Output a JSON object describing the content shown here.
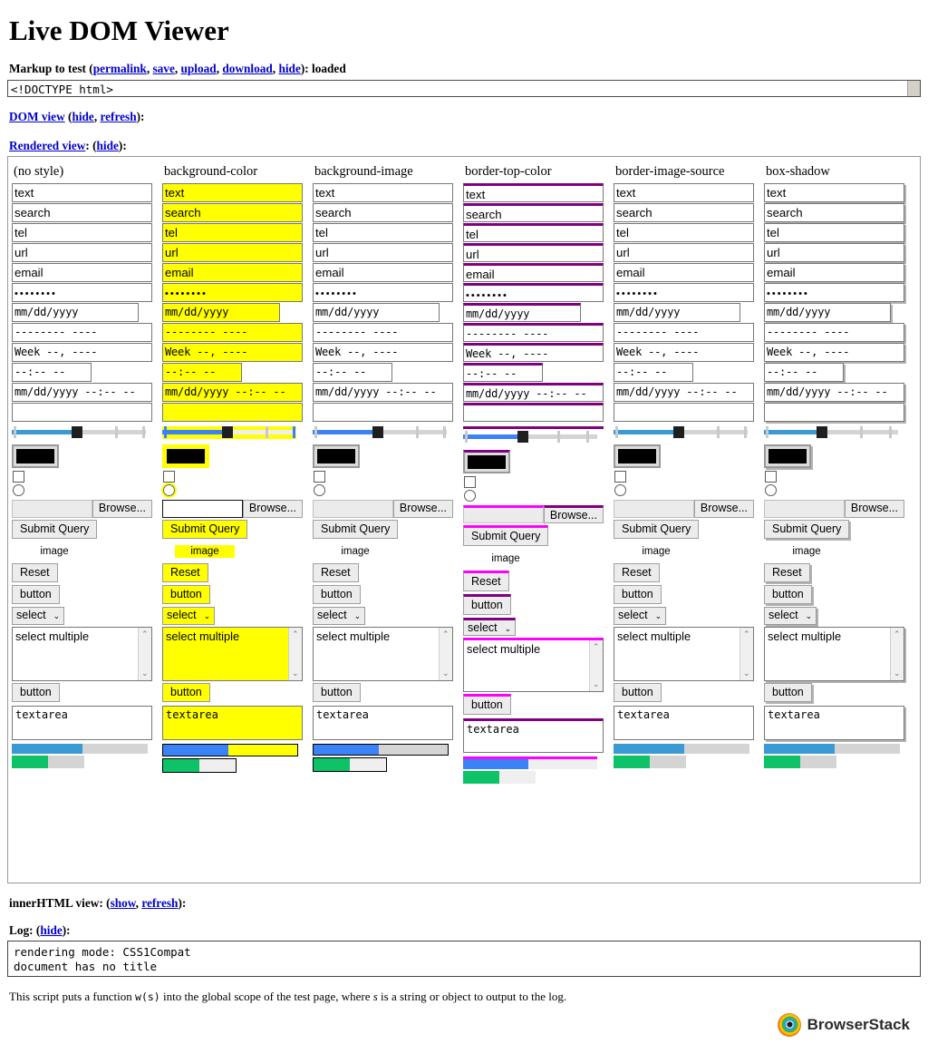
{
  "page": {
    "title": "Live DOM Viewer",
    "markup_label": "Markup to test",
    "markup_links": [
      "permalink",
      "save",
      "upload",
      "download",
      "hide"
    ],
    "markup_status": "loaded",
    "markup_value": "<!DOCTYPE html>",
    "dom_view_label": "DOM view",
    "dom_view_links": [
      "hide",
      "refresh"
    ],
    "rendered_view_label": "Rendered view",
    "rendered_view_links": [
      "hide"
    ],
    "innerhtml_label": "innerHTML view:",
    "innerhtml_links": [
      "show",
      "refresh"
    ],
    "log_label": "Log:",
    "log_links": [
      "hide"
    ],
    "log_text": "rendering mode: CSS1Compat\ndocument has no title",
    "note_pre": "This script puts a function ",
    "note_code": "w(s)",
    "note_mid": " into the global scope of the test page, where ",
    "note_var": "s",
    "note_post": " is a string or object to output to the log.",
    "footer_brand": "BrowserStack"
  },
  "columns": [
    {
      "id": "no-style",
      "header": "(no style)"
    },
    {
      "id": "background-color",
      "header": "background-color"
    },
    {
      "id": "background-image",
      "header": "background-image"
    },
    {
      "id": "border-top-color",
      "header": "border-top-color"
    },
    {
      "id": "border-image-source",
      "header": "border-image-source"
    },
    {
      "id": "box-shadow",
      "header": "box-shadow"
    }
  ],
  "controls": {
    "text": "text",
    "search": "search",
    "tel": "tel",
    "url": "url",
    "email": "email",
    "password": "••••••••",
    "date": "mm/dd/yyyy",
    "month": "-------- ----",
    "week": "Week --, ----",
    "time": "--:-- --",
    "datetime_local": "mm/dd/yyyy --:-- --",
    "number": "",
    "file_button": "Browse...",
    "submit": "Submit Query",
    "image": "image",
    "reset": "Reset",
    "button": "button",
    "select": "select",
    "select_chevron": "⌄",
    "select_multiple": "select multiple",
    "scroll_up": "⌃",
    "scroll_down": "⌄",
    "button2": "button",
    "textarea": "textarea"
  },
  "colors": {
    "link": "#0000cc",
    "highlight_yellow": "#ffff00",
    "border_purple": "#800080",
    "border_magenta": "#ff00ff",
    "range_blue": "#3b99d4",
    "progress_blue": "#3b99d4",
    "meter_green": "#0ec268",
    "track_grey": "#d4d4d4"
  }
}
